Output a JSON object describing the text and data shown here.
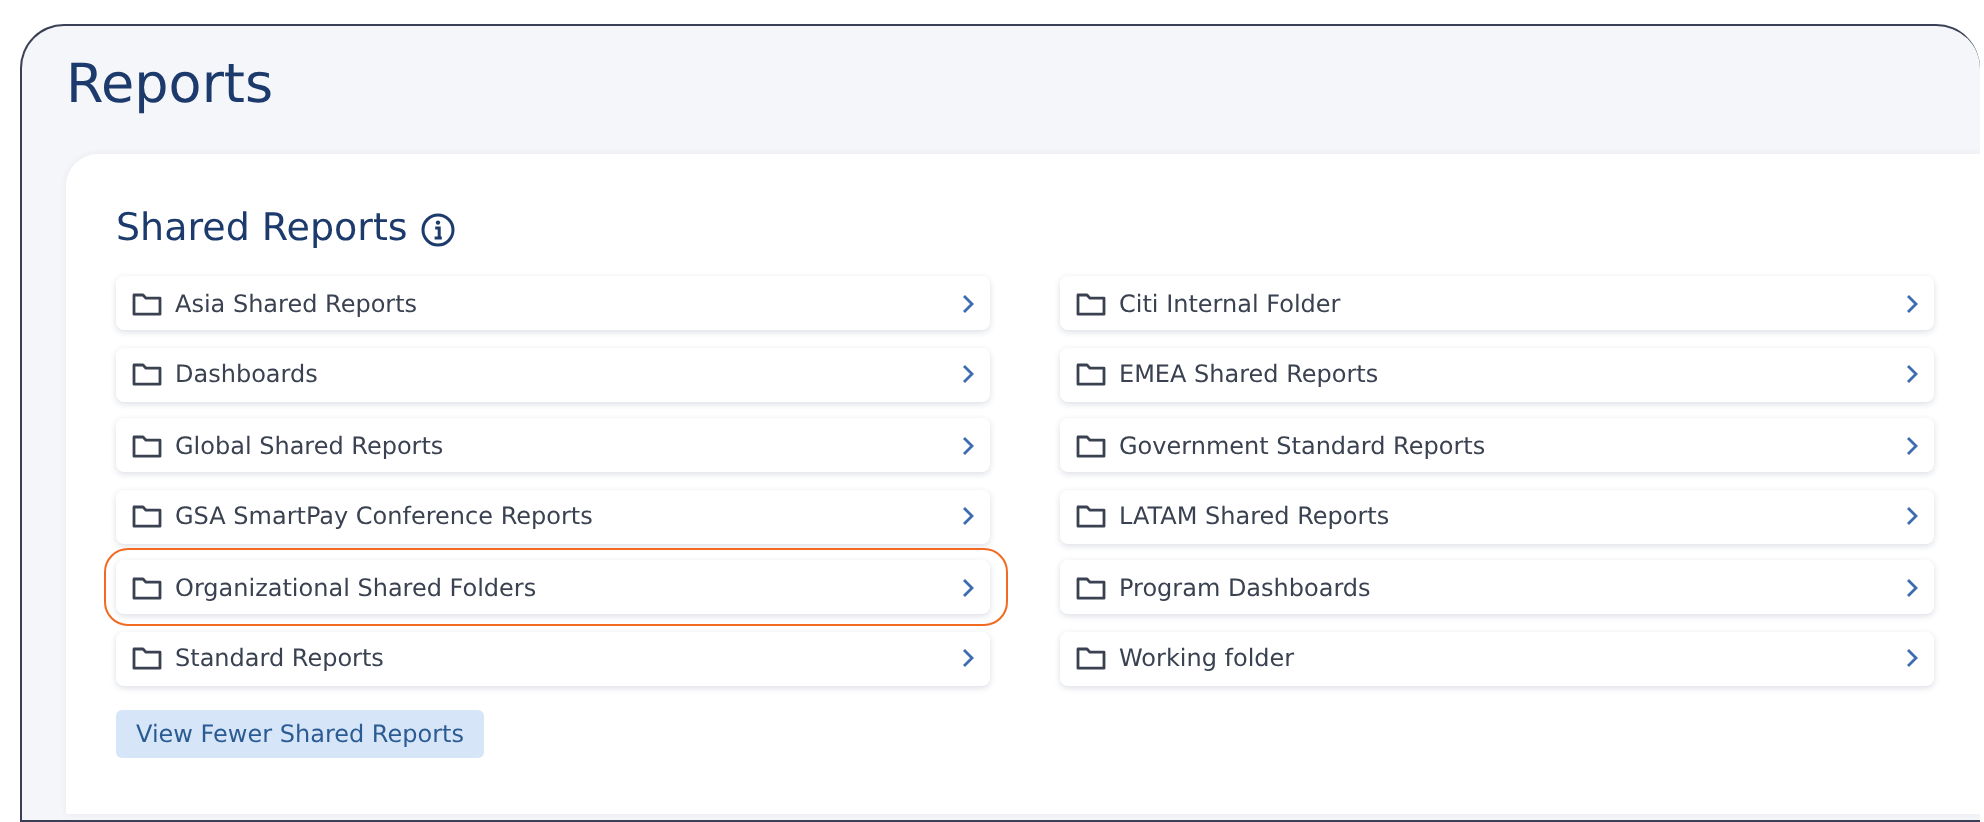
{
  "page": {
    "title": "Reports"
  },
  "section": {
    "title": "Shared Reports",
    "info_icon": true
  },
  "folders": [
    {
      "label": "Asia Shared Reports",
      "highlighted": false
    },
    {
      "label": "Dashboards",
      "highlighted": false
    },
    {
      "label": "Global Shared Reports",
      "highlighted": false
    },
    {
      "label": "GSA SmartPay Conference Reports",
      "highlighted": false
    },
    {
      "label": "Organizational Shared Folders",
      "highlighted": true
    },
    {
      "label": "Standard Reports",
      "highlighted": false
    },
    {
      "label": "Citi Internal Folder",
      "highlighted": false
    },
    {
      "label": "EMEA Shared Reports",
      "highlighted": false
    },
    {
      "label": "Government Standard Reports",
      "highlighted": false
    },
    {
      "label": "LATAM Shared Reports",
      "highlighted": false
    },
    {
      "label": "Program Dashboards",
      "highlighted": false
    },
    {
      "label": "Working folder",
      "highlighted": false
    }
  ],
  "toggle_button": {
    "label": "View Fewer Shared Reports"
  }
}
